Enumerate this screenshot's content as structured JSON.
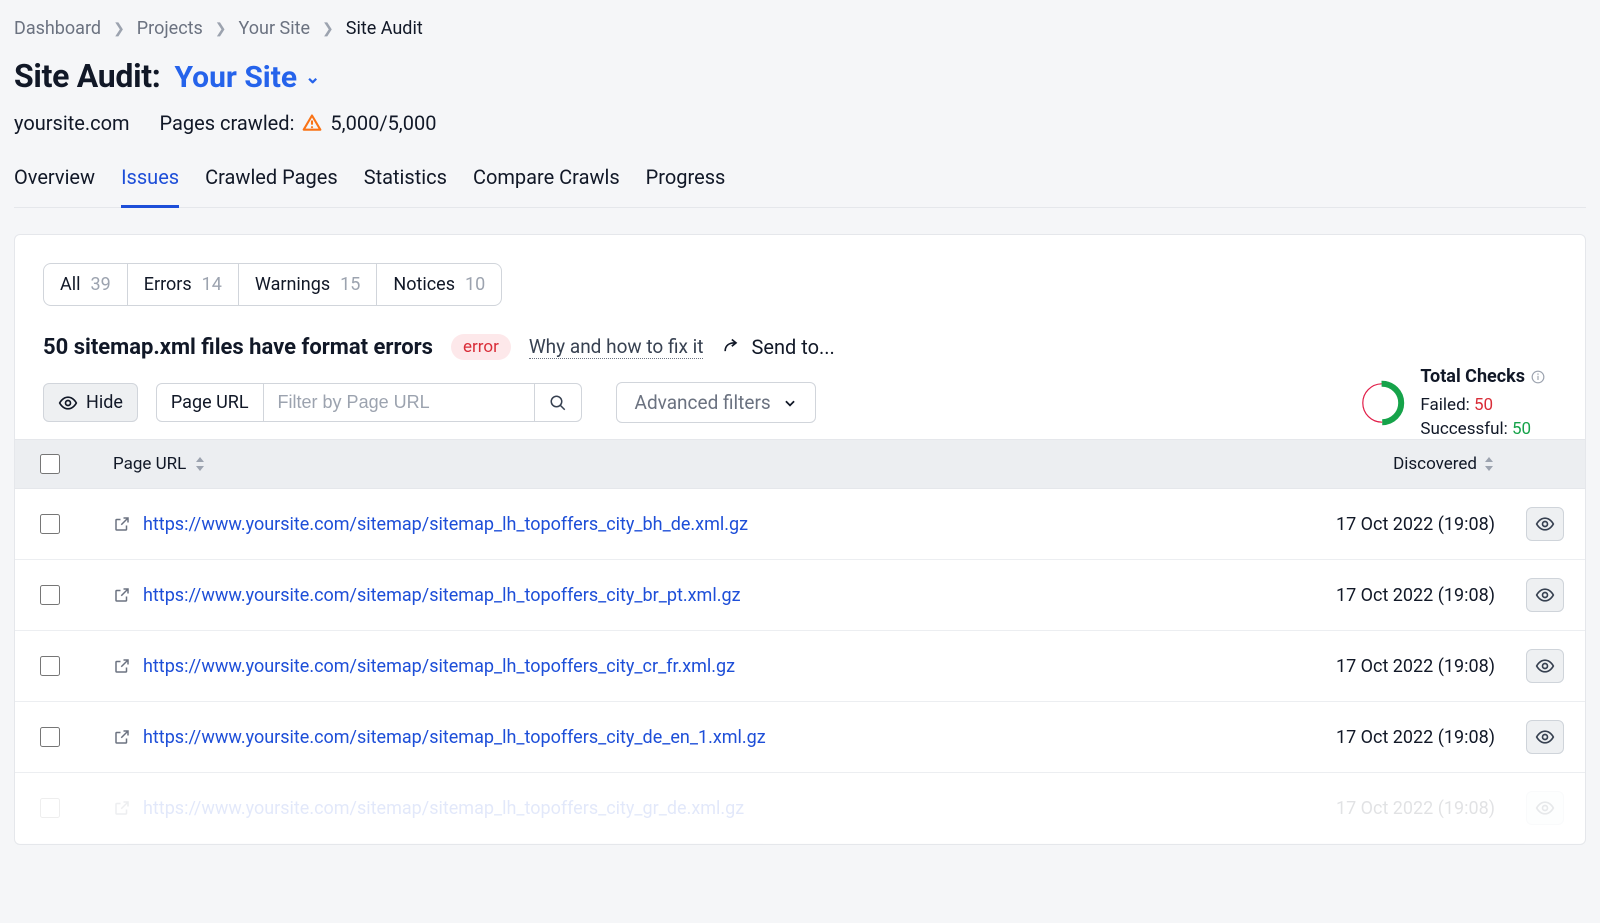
{
  "breadcrumb": {
    "items": [
      "Dashboard",
      "Projects",
      "Your Site"
    ],
    "current": "Site Audit"
  },
  "header": {
    "title": "Site Audit:",
    "site_name": "Your Site",
    "domain": "yoursite.com",
    "crawled_label": "Pages crawled:",
    "crawled_value": "5,000/5,000"
  },
  "tabs": {
    "items": [
      "Overview",
      "Issues",
      "Crawled Pages",
      "Statistics",
      "Compare Crawls",
      "Progress"
    ],
    "active": 1
  },
  "filters": {
    "all_label": "All",
    "all_count": "39",
    "errors_label": "Errors",
    "errors_count": "14",
    "warnings_label": "Warnings",
    "warnings_count": "15",
    "notices_label": "Notices",
    "notices_count": "10"
  },
  "issue": {
    "title": "50 sitemap.xml files have format errors",
    "badge": "error",
    "why": "Why and how to fix it",
    "sendto": "Send to..."
  },
  "toolbar": {
    "hide": "Hide",
    "pageurl_prefix": "Page URL",
    "filter_placeholder": "Filter by Page URL",
    "advanced": "Advanced filters"
  },
  "checks": {
    "title": "Total Checks",
    "failed_label": "Failed:",
    "failed_value": "50",
    "successful_label": "Successful:",
    "successful_value": "50"
  },
  "table": {
    "col_url": "Page URL",
    "col_discovered": "Discovered",
    "rows": [
      {
        "url": "https://www.yoursite.com/sitemap/sitemap_lh_topoffers_city_bh_de.xml.gz",
        "discovered": "17 Oct 2022 (19:08)"
      },
      {
        "url": "https://www.yoursite.com/sitemap/sitemap_lh_topoffers_city_br_pt.xml.gz",
        "discovered": "17 Oct 2022 (19:08)"
      },
      {
        "url": "https://www.yoursite.com/sitemap/sitemap_lh_topoffers_city_cr_fr.xml.gz",
        "discovered": "17 Oct 2022 (19:08)"
      },
      {
        "url": "https://www.yoursite.com/sitemap/sitemap_lh_topoffers_city_de_en_1.xml.gz",
        "discovered": "17 Oct 2022 (19:08)"
      },
      {
        "url": "https://www.yoursite.com/sitemap/sitemap_lh_topoffers_city_gr_de.xml.gz",
        "discovered": "17 Oct 2022 (19:08)"
      }
    ]
  }
}
